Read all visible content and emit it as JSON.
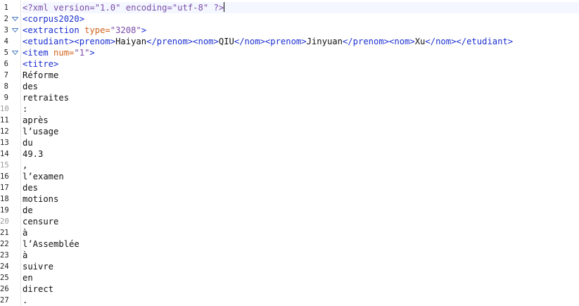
{
  "editor": {
    "colors": {
      "declaration": "#7a4ca8",
      "tag": "#1a2fd0",
      "attribute": "#d2631a",
      "attribute_value": "#7a4ca8",
      "text": "#111111"
    },
    "line_numbers": [
      "1",
      "2",
      "3",
      "4",
      "5",
      "6",
      "7",
      "8",
      "9",
      "10",
      "11",
      "12",
      "13",
      "14",
      "15",
      "16",
      "17",
      "18",
      "19",
      "20",
      "21",
      "22",
      "23",
      "24",
      "25",
      "26",
      "27"
    ],
    "fold_markers": [
      "2",
      "3",
      "5"
    ],
    "lines": {
      "l1": {
        "decl_open": "<?xml ",
        "attr1": "version=",
        "val1": "\"1.0\"",
        "sp": " ",
        "attr2": "encoding=",
        "val2": "\"utf-8\"",
        "decl_close": " ?>"
      },
      "l2": {
        "tag": "<corpus2020>"
      },
      "l3": {
        "open": "<extraction ",
        "attr": "type=",
        "val": "\"3208\"",
        "close": ">"
      },
      "l4": {
        "t1": "<etudiant>",
        "t2": "<prenom>",
        "x1": "Haiyan",
        "t3": "</prenom>",
        "t4": "<nom>",
        "x2": "QIU",
        "t5": "</nom>",
        "t6": "<prenom>",
        "x3": "Jinyuan",
        "t7": "</prenom>",
        "t8": "<nom>",
        "x4": "Xu",
        "t9": "</nom>",
        "t10": "</etudiant>"
      },
      "l5": {
        "open": "<item ",
        "attr": "num=",
        "val": "\"1\"",
        "close": ">"
      },
      "l6": {
        "tag": "<titre>"
      },
      "words": [
        "Réforme",
        "des",
        "retraites",
        ":",
        "après",
        "l’usage",
        "du",
        "49.3",
        ",",
        "l’examen",
        "des",
        "motions",
        "de",
        "censure",
        "à",
        "l’Assemblée",
        "à",
        "suivre",
        "en",
        "direct",
        "."
      ]
    }
  }
}
